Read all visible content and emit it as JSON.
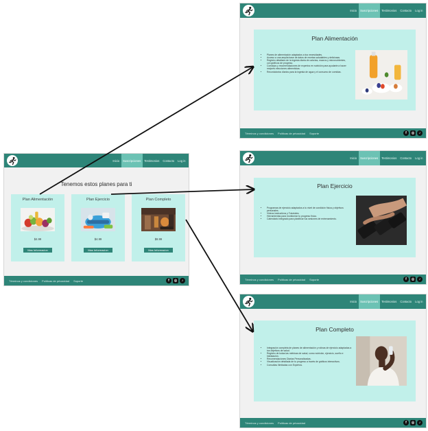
{
  "colors": {
    "nav": "#2e8578",
    "active_tab": "#6cc2b4",
    "card": "#c1f0ea",
    "button": "#2e8578",
    "page_bg": "#f1f1f1"
  },
  "nav": {
    "logo_icon": "runner-logo-icon",
    "items": [
      "Inicio",
      "Suscripciones",
      "Testimonios",
      "Contacto",
      "Log in"
    ]
  },
  "footer": {
    "links": [
      "Términos y condiciones",
      "Políticas de privacidad",
      "Soporte"
    ],
    "social_icons": [
      "facebook-icon",
      "instagram-icon",
      "tiktok-icon"
    ]
  },
  "overview": {
    "heading": "Tenemos estos planes para ti",
    "plans": [
      {
        "title": "Plan Alimentación",
        "price": "$4.99",
        "button": "Mas Informacion"
      },
      {
        "title": "Plan Ejercicio",
        "price": "$4.99",
        "button": "Mas Informacion"
      },
      {
        "title": "Plan Completo",
        "price": "$8.99",
        "button": "Mas Informacion"
      }
    ]
  },
  "details": [
    {
      "title": "Plan Alimentación",
      "bullets": [
        "Planes de alimentación adaptados a tus necesidades.",
        "Acceso a una amplia base de datos de recetas saludables y deliciosas.",
        "Registro detallado de la ingesta diaria de calorías, macros y micronutrientes, con gráficos de progreso.",
        "Consejos y recomendaciones de expertos en nutrición para ayudarte a hacer mejores elecciones alimenticias.",
        "Recordatorios diarios para la ingesta de agua y el consumo de comidas."
      ]
    },
    {
      "title": "Plan Ejercicio",
      "bullets": [
        "Programas de ejercicio adaptados a tu nivel de condición física y objetivos personales.",
        "Videos instructivos y Tutoriales.",
        "Herramientas para monitorear tu progreso físico.",
        "Calendario integrado para planificar tus sesiones de entrenamiento."
      ]
    },
    {
      "title": "Plan Completo",
      "bullets": [
        "Integración completa de planes de alimentación y rutinas de ejercicio adaptadas a tus objetivos de salud.",
        "Registro de todas las métricas de salud, como nutrición, ejercicio, sueño e hidratación.",
        "Recomendaciones Diarias Personalizadas.",
        "Visualización detallada de tu progreso a través de gráficos interactivos.",
        "Consultas Ilimitadas con Expertos."
      ]
    }
  ]
}
